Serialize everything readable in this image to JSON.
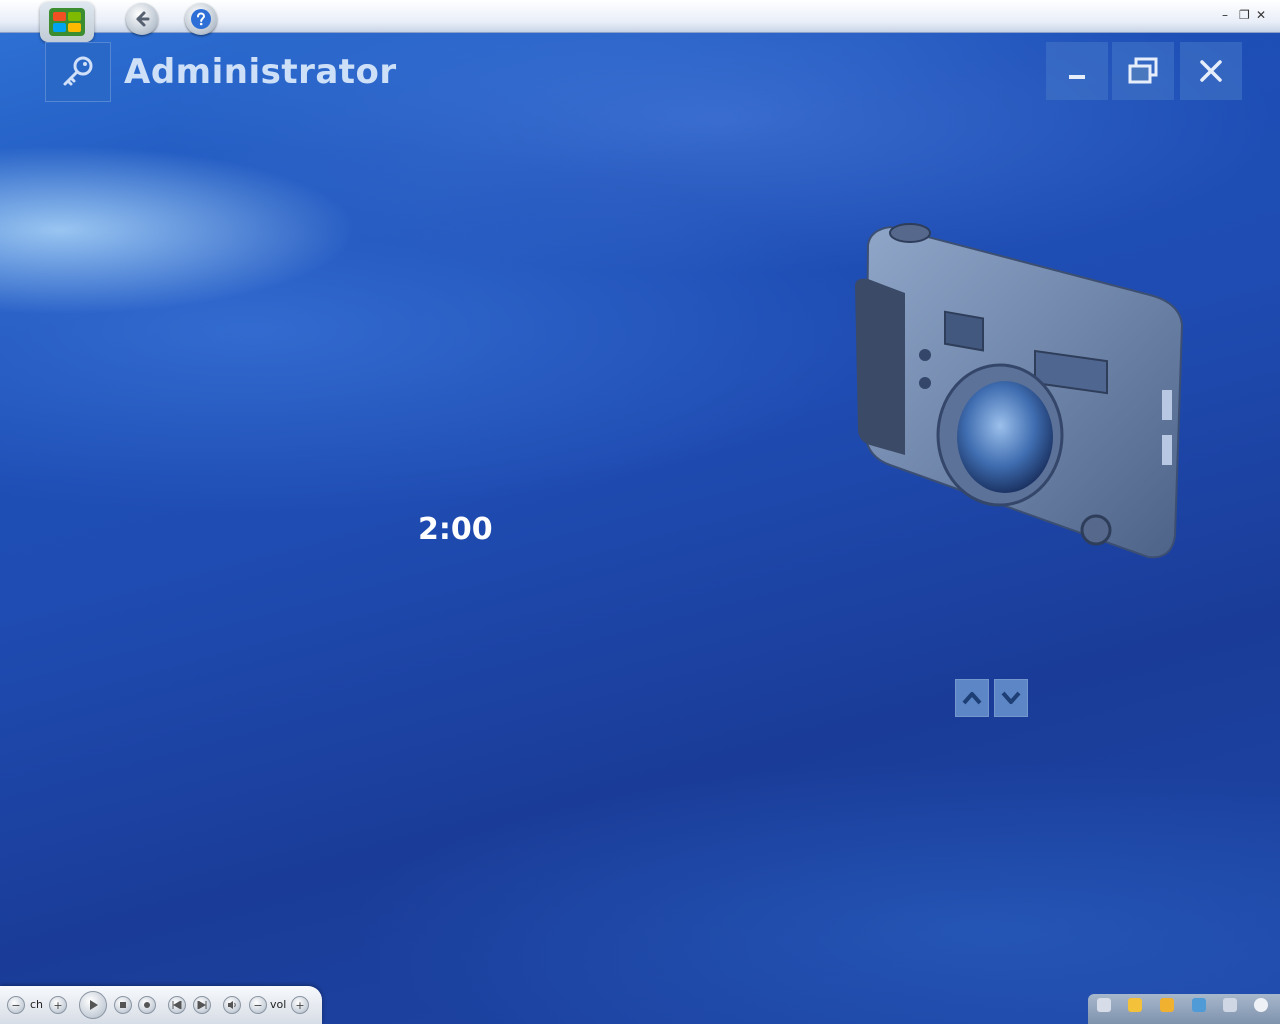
{
  "header": {
    "title": "Administrator"
  },
  "center": {
    "timer": "2:00"
  },
  "window_controls": {
    "minimize_glyph": "–",
    "restore_glyph": "❐",
    "close_glyph": "✕"
  },
  "transport": {
    "ch_label": "ch",
    "vol_label": "vol",
    "minus": "−",
    "plus": "+"
  },
  "icons": {
    "start": "windows-logo-icon",
    "back": "back-arrow-icon",
    "help": "help-icon",
    "key": "key-icon",
    "camera": "camera-icon"
  },
  "colors": {
    "background": "#1f4cb2",
    "title": "#cde0f8",
    "timer": "#ffffff",
    "tile": "#2a68c8"
  }
}
